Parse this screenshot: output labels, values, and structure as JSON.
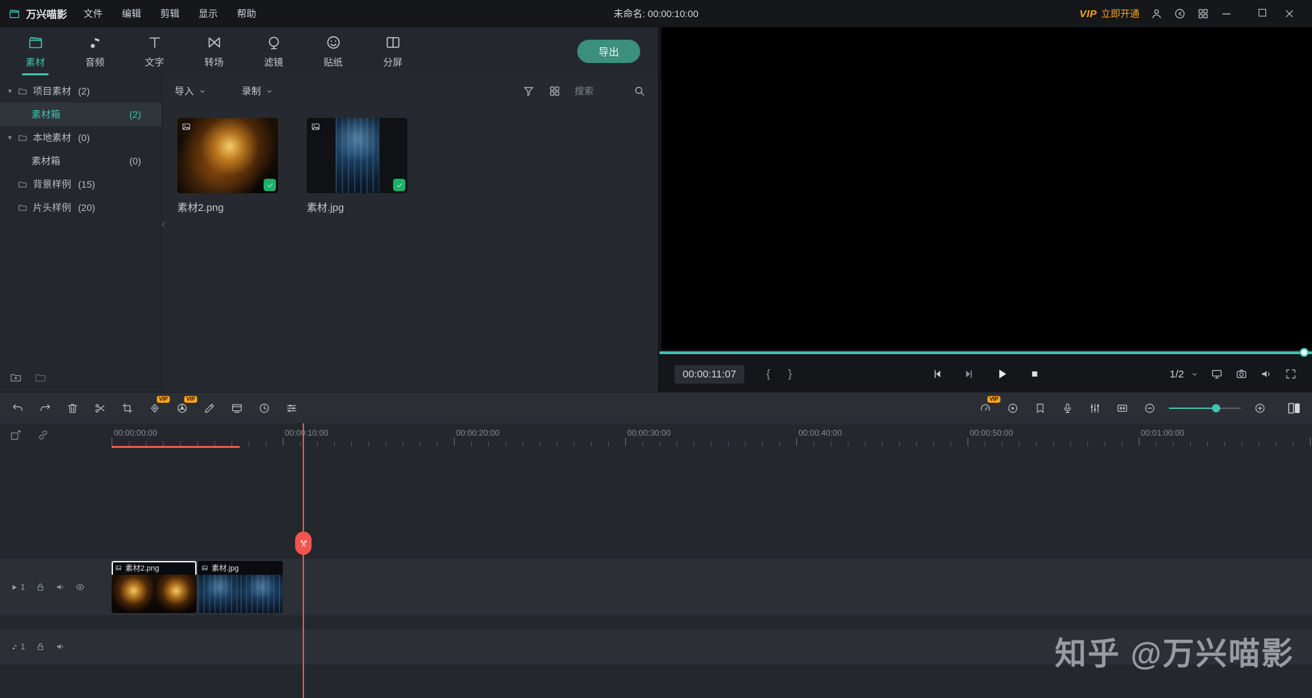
{
  "colors": {
    "accent": "#3ec3ae",
    "playhead_red": "#f4544e",
    "vip_orange": "#ffa21a",
    "check_green": "#19b26b"
  },
  "titlebar": {
    "app_name": "万兴喵影",
    "menus": [
      "文件",
      "编辑",
      "剪辑",
      "显示",
      "帮助"
    ],
    "document_title": "未命名: 00:00:10:00",
    "vip_badge": "VIP",
    "vip_action": "立即开通"
  },
  "media_panel": {
    "tabs": [
      {
        "label": "素材",
        "active": true
      },
      {
        "label": "音频",
        "active": false
      },
      {
        "label": "文字",
        "active": false
      },
      {
        "label": "转场",
        "active": false
      },
      {
        "label": "滤镜",
        "active": false
      },
      {
        "label": "贴纸",
        "active": false
      },
      {
        "label": "分屏",
        "active": false
      }
    ],
    "export_label": "导出",
    "sidebar": {
      "items": [
        {
          "label": "项目素材",
          "count": "(2)"
        },
        {
          "label": "素材箱",
          "count": "(2)",
          "selected": true
        },
        {
          "label": "本地素材",
          "count": "(0)"
        },
        {
          "label": "素材箱",
          "count": "(0)"
        },
        {
          "label": "背景样例",
          "count": "(15)"
        },
        {
          "label": "片头样例",
          "count": "(20)"
        }
      ]
    },
    "toolbar": {
      "import_label": "导入",
      "record_label": "录制",
      "search_placeholder": "搜索"
    },
    "items": [
      {
        "name": "素材2.png"
      },
      {
        "name": "素材.jpg"
      }
    ]
  },
  "player": {
    "current_time": "00:00:11:07",
    "mark_in": "{",
    "mark_out": "}",
    "page_indicator": "1/2"
  },
  "timeline": {
    "vip_badge": "VIP",
    "ruler_labels": [
      "00:00:00:00",
      "00:00:10:00",
      "00:00:20:00",
      "00:00:30:00",
      "00:00:40:00",
      "00:00:50:00",
      "00:01:00:00"
    ],
    "video_track": {
      "number": "1",
      "clips": [
        {
          "name": "素材2.png"
        },
        {
          "name": "素材.jpg"
        }
      ]
    },
    "audio_track": {
      "number": "1"
    }
  },
  "watermark": "知乎 @万兴喵影"
}
